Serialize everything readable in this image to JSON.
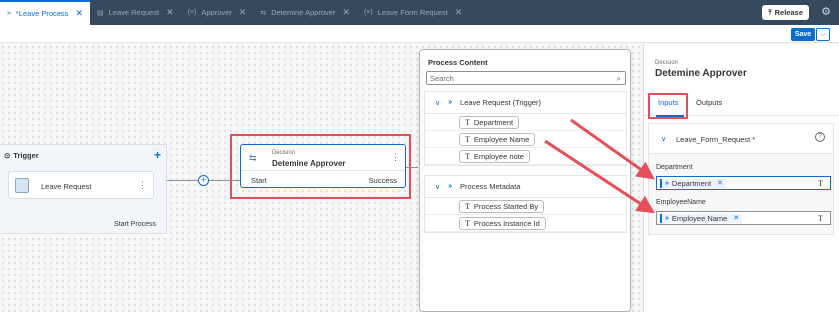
{
  "tabs": [
    {
      "icon": "»",
      "label": "*Leave Process",
      "active": true
    },
    {
      "icon": "▤",
      "label": "Leave Request",
      "active": false
    },
    {
      "icon": "(×)",
      "label": "Approver",
      "active": false
    },
    {
      "icon": "⇆",
      "label": "Detemine Approver",
      "active": false
    },
    {
      "icon": "(×)",
      "label": "Leave Form Request",
      "active": false
    }
  ],
  "header": {
    "release_label": "Release",
    "save_label": "Save"
  },
  "trigger": {
    "title": "Trigger",
    "card_label": "Leave Request",
    "footer": "Start Process"
  },
  "decision": {
    "type_label": "Decision",
    "title": "Detemine Approver",
    "start_label": "Start",
    "success_label": "Success"
  },
  "process_content": {
    "title": "Process Content",
    "search_placeholder": "Search",
    "groups": [
      {
        "label": "Leave Request (Trigger)",
        "items": [
          "Department",
          "Employee Name",
          "Employee note"
        ]
      },
      {
        "label": "Process Metadata",
        "items": [
          "Process Started By",
          "Process Instance Id"
        ]
      }
    ]
  },
  "right_panel": {
    "type_label": "Decision",
    "title": "Detemine Approver",
    "tabs": [
      "Inputs",
      "Outputs"
    ],
    "section_title": "Leave_Form_Request *",
    "fields": [
      {
        "label": "Department",
        "token": "Department"
      },
      {
        "label": "EmployeeName",
        "token": "Employee Name"
      }
    ]
  },
  "colors": {
    "accent": "#0a6ed1",
    "annotation": "#e54f5a",
    "shell": "#354a5f"
  }
}
